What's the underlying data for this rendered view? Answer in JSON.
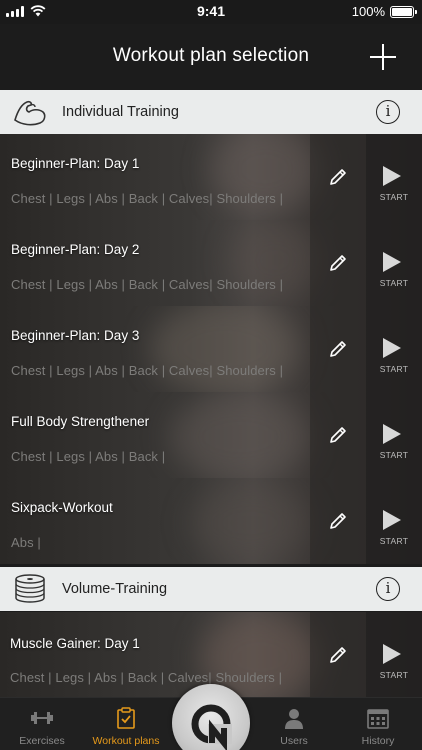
{
  "status": {
    "time": "9:41",
    "battery": "100%"
  },
  "nav": {
    "title": "Workout plan selection"
  },
  "sections": [
    {
      "label": "Individual Training",
      "icon": "flexed-arm-icon"
    },
    {
      "label": "Volume-Training",
      "icon": "weight-plates-icon"
    }
  ],
  "plans": [
    {
      "name": "Beginner-Plan: Day 1",
      "muscles": "Chest | Legs | Abs | Back | Calves| Shoulders |",
      "start": "START"
    },
    {
      "name": "Beginner-Plan: Day 2",
      "muscles": "Chest | Legs | Abs | Back | Calves| Shoulders |",
      "start": "START"
    },
    {
      "name": "Beginner-Plan: Day 3",
      "muscles": "Chest | Legs | Abs | Back | Calves| Shoulders |",
      "start": "START"
    },
    {
      "name": "Full Body Strengthener",
      "muscles": "Chest | Legs | Abs | Back |",
      "start": "START"
    },
    {
      "name": "Sixpack-Workout",
      "muscles": "Abs |",
      "start": "START"
    },
    {
      "name": "Muscle Gainer: Day 1",
      "muscles": "Chest | Legs | Abs | Back | Calves| Shoulders |",
      "start": "START"
    }
  ],
  "tabs": [
    {
      "label": "Exercises",
      "icon": "dumbbell-icon"
    },
    {
      "label": "Workout plans",
      "icon": "clipboard-check-icon",
      "active": true
    },
    {
      "label": "Users",
      "icon": "user-icon"
    },
    {
      "label": "History",
      "icon": "calendar-icon"
    }
  ],
  "colors": {
    "accent": "#e69a1b",
    "section_bg": "#eaecec",
    "muted_text": "#7d7c7a"
  }
}
